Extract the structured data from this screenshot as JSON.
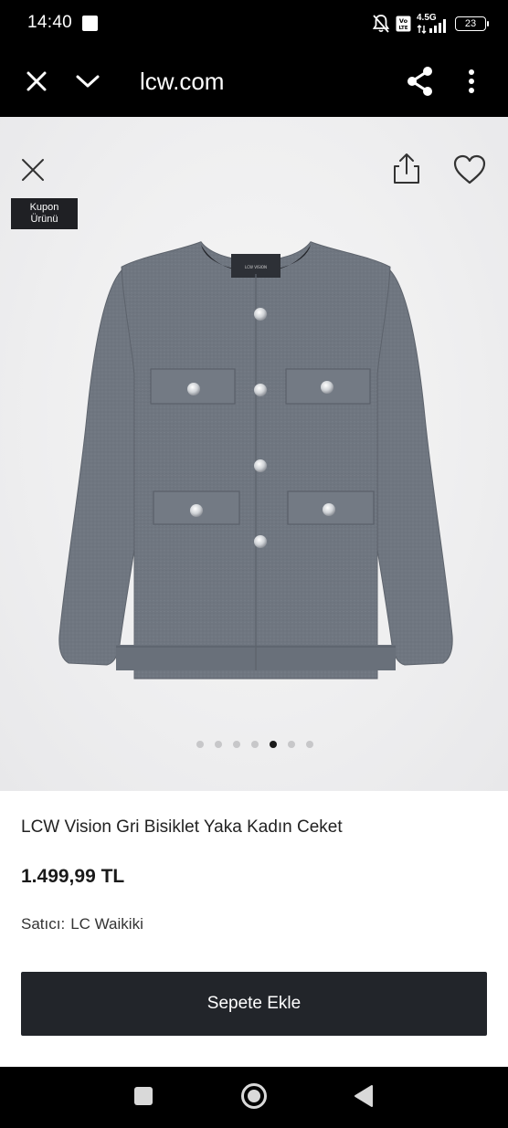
{
  "status_bar": {
    "time": "14:40",
    "network": "4.5G",
    "volte": "Vo LTE",
    "battery": "23",
    "icons": [
      "notification-square-icon",
      "mute-bell-icon",
      "volte-icon",
      "signal-icon",
      "battery-icon"
    ]
  },
  "browser": {
    "url": "lcw.com",
    "icons": [
      "close-icon",
      "chevron-down-icon",
      "share-icon",
      "more-vertical-icon"
    ]
  },
  "gallery": {
    "badge_line1": "Kupon",
    "badge_line2": "Ürünü",
    "dots_count": 7,
    "active_dot": 4,
    "icons": [
      "close-icon",
      "upload-share-icon",
      "heart-icon"
    ],
    "label_on_garment": "LCW VISION"
  },
  "product": {
    "title": "LCW Vision Gri Bisiklet Yaka Kadın Ceket",
    "price": "1.499,99 TL",
    "seller_label": "Satıcı:",
    "seller_name": "LC Waikiki",
    "add_to_cart": "Sepete Ekle"
  },
  "nav": {
    "icons": [
      "recents-square-icon",
      "home-circle-icon",
      "back-triangle-icon"
    ]
  },
  "colors": {
    "button_bg": "#22252a",
    "jacket": "#6f7680",
    "badge_bg": "#1f2024"
  }
}
